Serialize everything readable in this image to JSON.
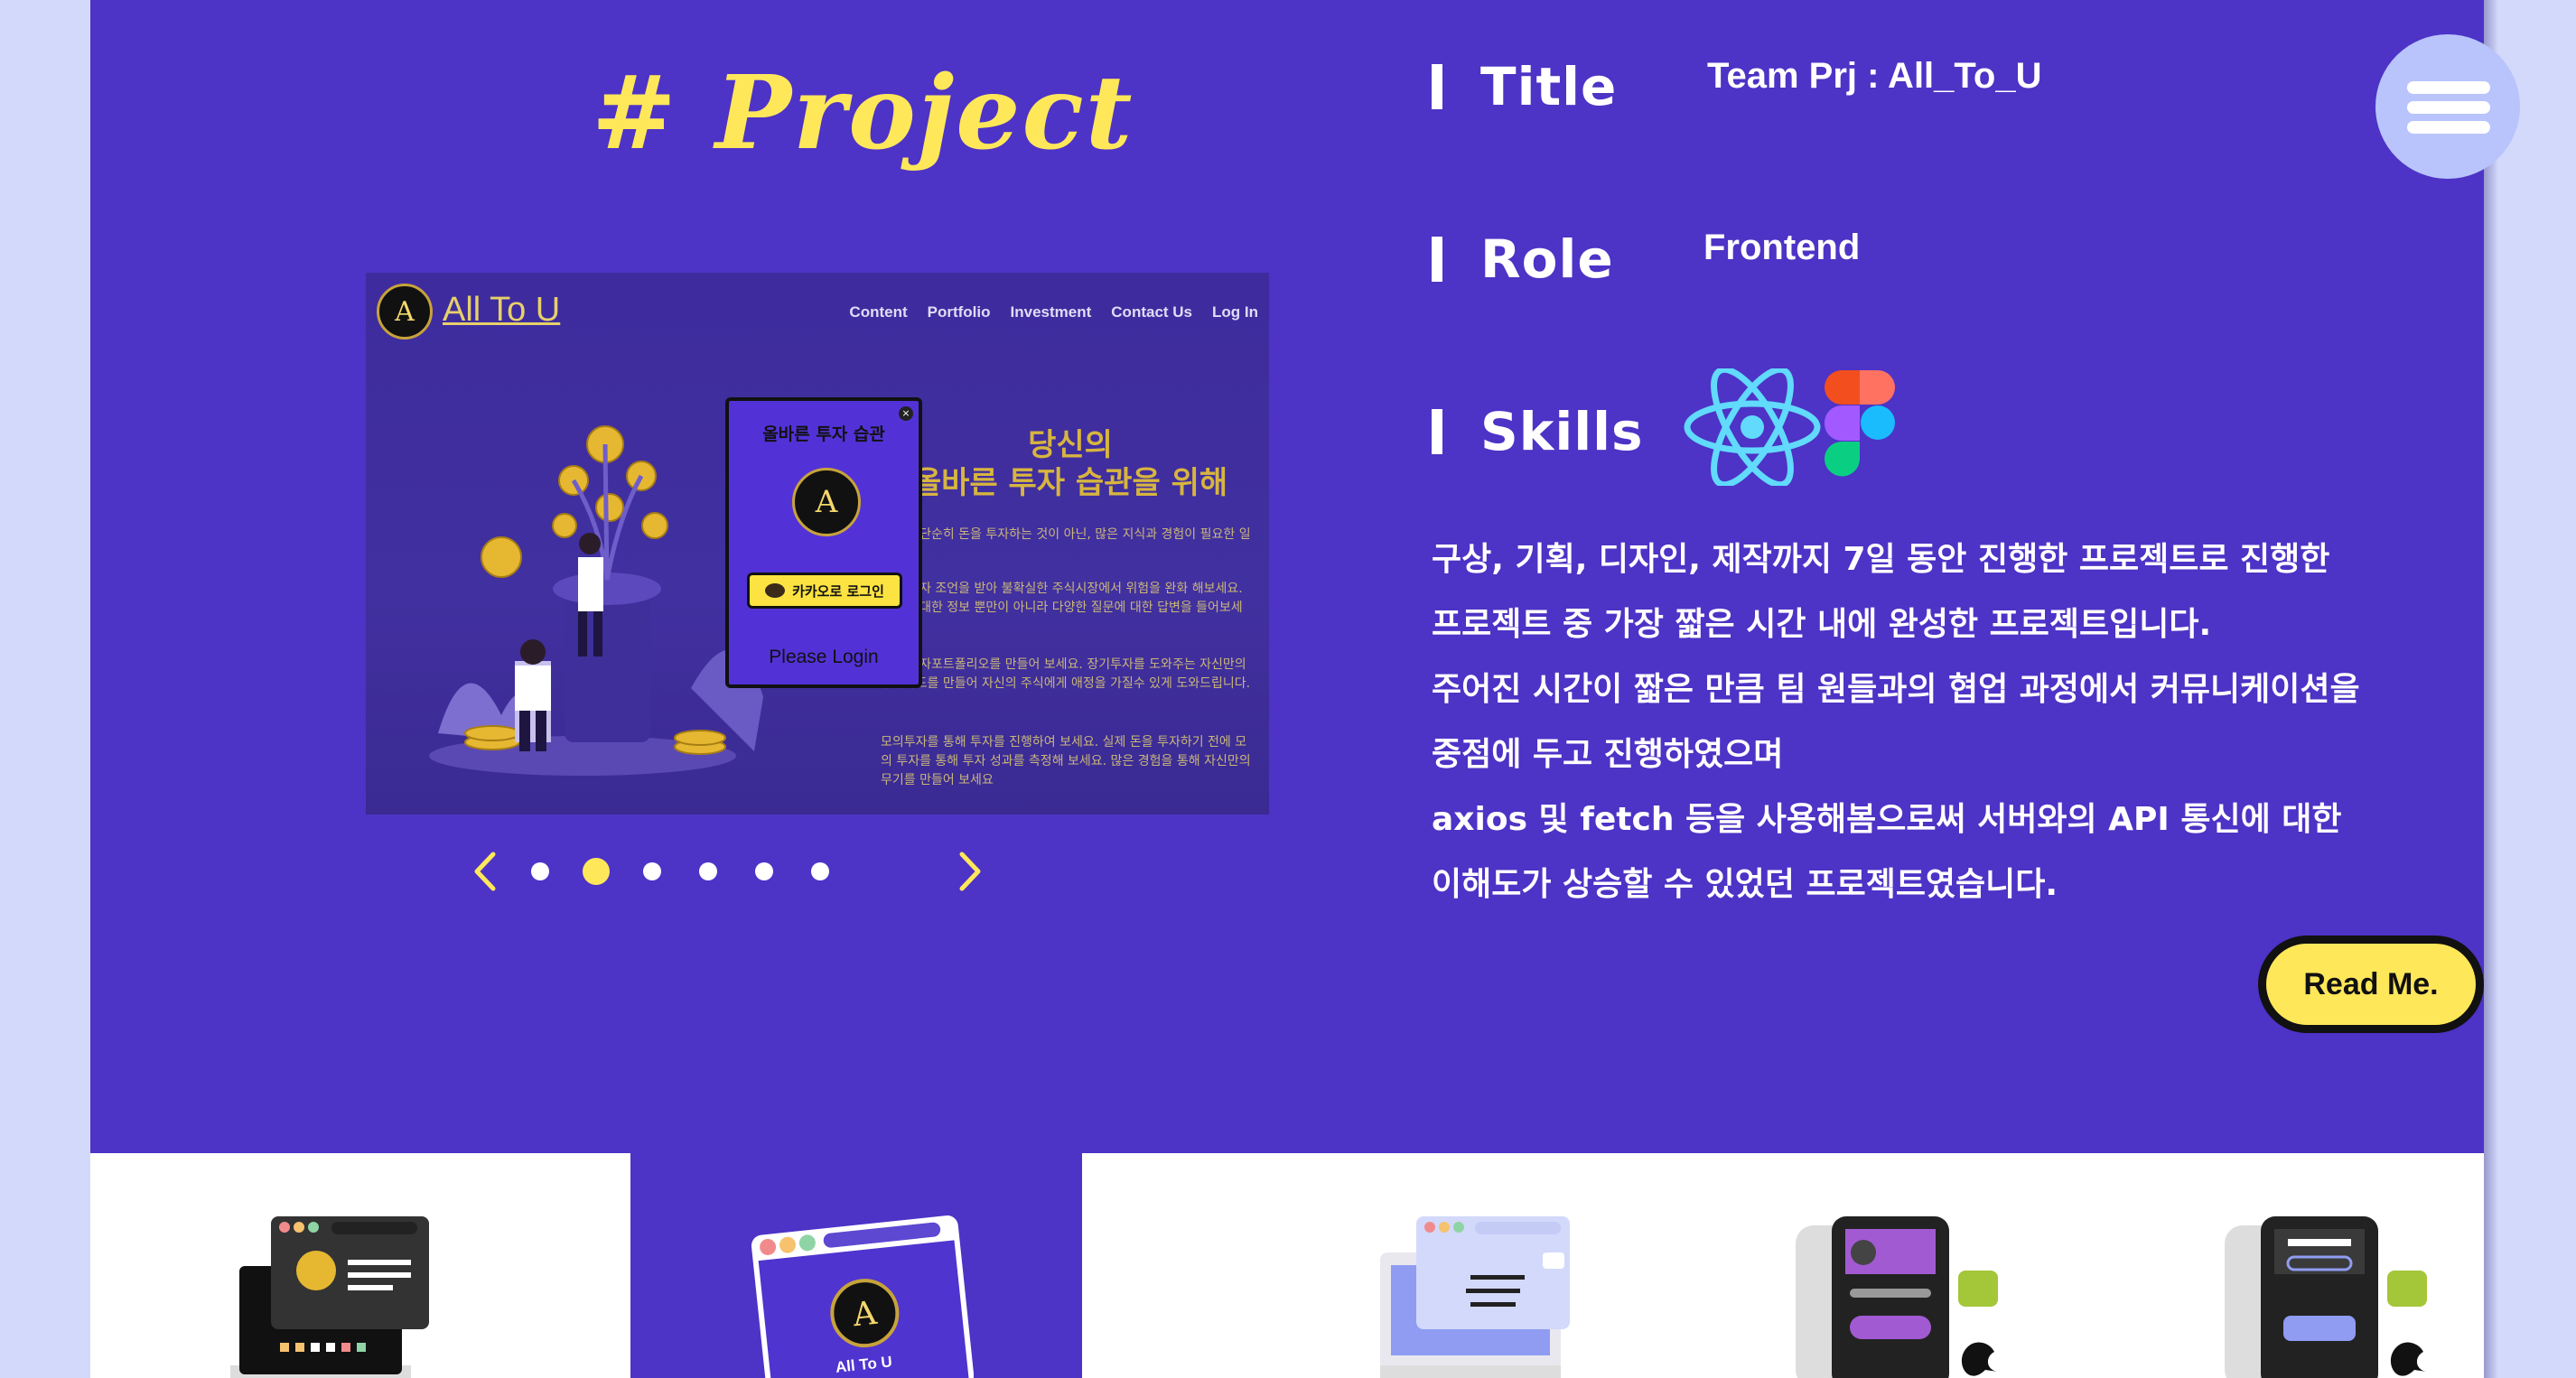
{
  "project": {
    "heading": "# Project",
    "screenshot": {
      "logo_letter": "A",
      "brand": "All To U",
      "nav": [
        "Content",
        "Portfolio",
        "Investment",
        "Contact Us",
        "Log In"
      ],
      "headline_1": "당신의",
      "headline_2": "올바른 투자 습관을 위해",
      "paragraphs": [
        "투자는 단순히 돈을 투자하는 것이 아닌, 많은 지식과 경험이 필요한 일입니다.",
        "전문 투자 조언을 받아 불확실한 주식시장에서 위험을 완화 해보세요. 기업에 대한 정보 뿐만이 아니라 다양한 질문에 대한 답변을 들어보세요.",
        "나의 투자포트폴리오를 만들어 보세요. 장기투자를 도와주는 자신만의 주식카드를 만들어 자신의 주식에게 애정을 가질수 있게 도와드립니다.",
        "모의투자를 통해 투자를 진행하여 보세요. 실제 돈을 투자하기 전에 모의 투자를 통해 투자 성과를 측정해 보세요. 많은 경험을 통해 자신만의 무기를 만들어 보세요"
      ],
      "modal": {
        "title": "올바른 투자 습관",
        "close": "×",
        "logo_letter": "A",
        "kakao_label": "카카오로 로그인",
        "login_label": "Please Login"
      }
    },
    "carousel": {
      "dot_count": 6,
      "active_index": 1
    },
    "title_label": "Title",
    "title_value": "Team Prj : All_To_U",
    "role_label": "Role",
    "role_value": "Frontend",
    "skills_label": "Skills",
    "skills_icons": [
      "react-icon",
      "figma-icon"
    ],
    "description": [
      "구상, 기획, 디자인, 제작까지 7일 동안 진행한 프로젝트로 진행한",
      "프로젝트 중 가장 짧은 시간 내에 완성한 프로젝트입니다.",
      "주어진 시간이 짧은 만큼 팀 원들과의 협업 과정에서 커뮤니케이션을",
      "중점에 두고 진행하였으며",
      "axios 및 fetch 등을 사용해봄으로써 서버와의 API 통신에 대한",
      "이해도가 상승할 수 있었던 프로젝트였습니다."
    ],
    "read_more": "Read Me."
  },
  "bottom_thumbs": [
    {
      "icon": "browser-window-icon",
      "active": false
    },
    {
      "icon": "all-to-u-icon",
      "caption": "All To U",
      "active": true
    },
    {
      "icon": "browser-message-icon",
      "active": false
    },
    {
      "icon": "android-ios-app-icon",
      "active": false
    },
    {
      "icon": "android-ios-app-icon",
      "active": false
    }
  ],
  "colors": {
    "page_bg": "#4d33c6",
    "accent_yellow": "#ffe75a",
    "outer_bg": "#d3d9fb",
    "menu_btn": "#b8c4fb"
  }
}
